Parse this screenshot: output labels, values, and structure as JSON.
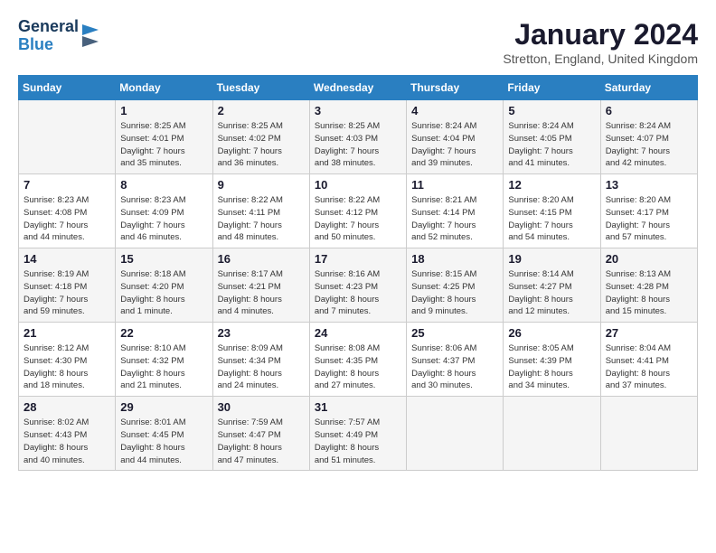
{
  "header": {
    "logo_general": "General",
    "logo_blue": "Blue",
    "month": "January 2024",
    "location": "Stretton, England, United Kingdom"
  },
  "days_of_week": [
    "Sunday",
    "Monday",
    "Tuesday",
    "Wednesday",
    "Thursday",
    "Friday",
    "Saturday"
  ],
  "weeks": [
    [
      {
        "day": "",
        "info": ""
      },
      {
        "day": "1",
        "info": "Sunrise: 8:25 AM\nSunset: 4:01 PM\nDaylight: 7 hours\nand 35 minutes."
      },
      {
        "day": "2",
        "info": "Sunrise: 8:25 AM\nSunset: 4:02 PM\nDaylight: 7 hours\nand 36 minutes."
      },
      {
        "day": "3",
        "info": "Sunrise: 8:25 AM\nSunset: 4:03 PM\nDaylight: 7 hours\nand 38 minutes."
      },
      {
        "day": "4",
        "info": "Sunrise: 8:24 AM\nSunset: 4:04 PM\nDaylight: 7 hours\nand 39 minutes."
      },
      {
        "day": "5",
        "info": "Sunrise: 8:24 AM\nSunset: 4:05 PM\nDaylight: 7 hours\nand 41 minutes."
      },
      {
        "day": "6",
        "info": "Sunrise: 8:24 AM\nSunset: 4:07 PM\nDaylight: 7 hours\nand 42 minutes."
      }
    ],
    [
      {
        "day": "7",
        "info": "Sunrise: 8:23 AM\nSunset: 4:08 PM\nDaylight: 7 hours\nand 44 minutes."
      },
      {
        "day": "8",
        "info": "Sunrise: 8:23 AM\nSunset: 4:09 PM\nDaylight: 7 hours\nand 46 minutes."
      },
      {
        "day": "9",
        "info": "Sunrise: 8:22 AM\nSunset: 4:11 PM\nDaylight: 7 hours\nand 48 minutes."
      },
      {
        "day": "10",
        "info": "Sunrise: 8:22 AM\nSunset: 4:12 PM\nDaylight: 7 hours\nand 50 minutes."
      },
      {
        "day": "11",
        "info": "Sunrise: 8:21 AM\nSunset: 4:14 PM\nDaylight: 7 hours\nand 52 minutes."
      },
      {
        "day": "12",
        "info": "Sunrise: 8:20 AM\nSunset: 4:15 PM\nDaylight: 7 hours\nand 54 minutes."
      },
      {
        "day": "13",
        "info": "Sunrise: 8:20 AM\nSunset: 4:17 PM\nDaylight: 7 hours\nand 57 minutes."
      }
    ],
    [
      {
        "day": "14",
        "info": "Sunrise: 8:19 AM\nSunset: 4:18 PM\nDaylight: 7 hours\nand 59 minutes."
      },
      {
        "day": "15",
        "info": "Sunrise: 8:18 AM\nSunset: 4:20 PM\nDaylight: 8 hours\nand 1 minute."
      },
      {
        "day": "16",
        "info": "Sunrise: 8:17 AM\nSunset: 4:21 PM\nDaylight: 8 hours\nand 4 minutes."
      },
      {
        "day": "17",
        "info": "Sunrise: 8:16 AM\nSunset: 4:23 PM\nDaylight: 8 hours\nand 7 minutes."
      },
      {
        "day": "18",
        "info": "Sunrise: 8:15 AM\nSunset: 4:25 PM\nDaylight: 8 hours\nand 9 minutes."
      },
      {
        "day": "19",
        "info": "Sunrise: 8:14 AM\nSunset: 4:27 PM\nDaylight: 8 hours\nand 12 minutes."
      },
      {
        "day": "20",
        "info": "Sunrise: 8:13 AM\nSunset: 4:28 PM\nDaylight: 8 hours\nand 15 minutes."
      }
    ],
    [
      {
        "day": "21",
        "info": "Sunrise: 8:12 AM\nSunset: 4:30 PM\nDaylight: 8 hours\nand 18 minutes."
      },
      {
        "day": "22",
        "info": "Sunrise: 8:10 AM\nSunset: 4:32 PM\nDaylight: 8 hours\nand 21 minutes."
      },
      {
        "day": "23",
        "info": "Sunrise: 8:09 AM\nSunset: 4:34 PM\nDaylight: 8 hours\nand 24 minutes."
      },
      {
        "day": "24",
        "info": "Sunrise: 8:08 AM\nSunset: 4:35 PM\nDaylight: 8 hours\nand 27 minutes."
      },
      {
        "day": "25",
        "info": "Sunrise: 8:06 AM\nSunset: 4:37 PM\nDaylight: 8 hours\nand 30 minutes."
      },
      {
        "day": "26",
        "info": "Sunrise: 8:05 AM\nSunset: 4:39 PM\nDaylight: 8 hours\nand 34 minutes."
      },
      {
        "day": "27",
        "info": "Sunrise: 8:04 AM\nSunset: 4:41 PM\nDaylight: 8 hours\nand 37 minutes."
      }
    ],
    [
      {
        "day": "28",
        "info": "Sunrise: 8:02 AM\nSunset: 4:43 PM\nDaylight: 8 hours\nand 40 minutes."
      },
      {
        "day": "29",
        "info": "Sunrise: 8:01 AM\nSunset: 4:45 PM\nDaylight: 8 hours\nand 44 minutes."
      },
      {
        "day": "30",
        "info": "Sunrise: 7:59 AM\nSunset: 4:47 PM\nDaylight: 8 hours\nand 47 minutes."
      },
      {
        "day": "31",
        "info": "Sunrise: 7:57 AM\nSunset: 4:49 PM\nDaylight: 8 hours\nand 51 minutes."
      },
      {
        "day": "",
        "info": ""
      },
      {
        "day": "",
        "info": ""
      },
      {
        "day": "",
        "info": ""
      }
    ]
  ]
}
